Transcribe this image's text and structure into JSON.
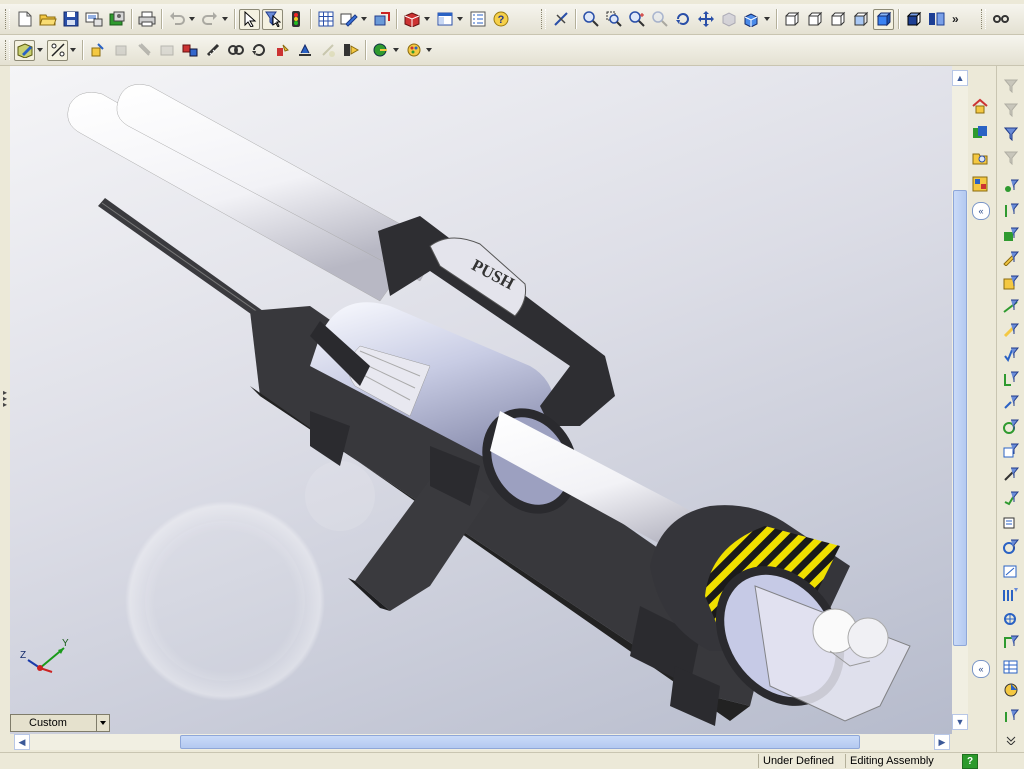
{
  "toolbar_standard": {
    "icons": [
      "new-document-icon",
      "open-folder-icon",
      "save-icon",
      "print-preview-icon",
      "options-icon",
      "print-icon",
      "undo-icon",
      "redo-icon",
      "select-icon",
      "select-filter-icon",
      "traffic-light-icon",
      "grid-icon",
      "sketch-icon",
      "move-component-icon",
      "insert-component-icon",
      "window-layout-icon",
      "properties-list-icon",
      "help-icon",
      "select-edges-icon",
      "zoom-to-fit-icon",
      "zoom-area-icon",
      "zoom-in-out-icon",
      "zoom-selection-icon",
      "rotate-view-icon",
      "pan-icon",
      "3d-view-icon",
      "view-orientation-icon",
      "front-view-icon",
      "back-view-icon",
      "left-view-icon",
      "right-view-icon",
      "shaded-view-icon",
      "section-view-icon",
      "hidden-lines-icon",
      "more-tools-icon",
      "linkage-icon"
    ]
  },
  "toolbar_assembly": {
    "icons": [
      "edit-component-icon",
      "smart-fasteners-icon",
      "insert-components-icon",
      "hide-show-icon",
      "change-transparency-icon",
      "mate-icon",
      "explode-icon",
      "measure-icon",
      "interference-icon",
      "move-icon",
      "rotate-component-icon",
      "smart-mates-icon",
      "feature-icon",
      "assembly-features-icon",
      "sensor-icon",
      "appearance-icon"
    ]
  },
  "viewport": {
    "push_label": "PUSH",
    "triad_labels": {
      "y": "Y",
      "z": "Z"
    },
    "view_combo": "Custom"
  },
  "status_bar": {
    "state": "Under Defined",
    "mode": "Editing Assembly",
    "help": "?"
  },
  "colors": {
    "accent_blue": "#316ac5",
    "hazard_yellow": "#f0e000",
    "model_dark": "#3a3a3e",
    "model_tube": "#eeeef4"
  }
}
